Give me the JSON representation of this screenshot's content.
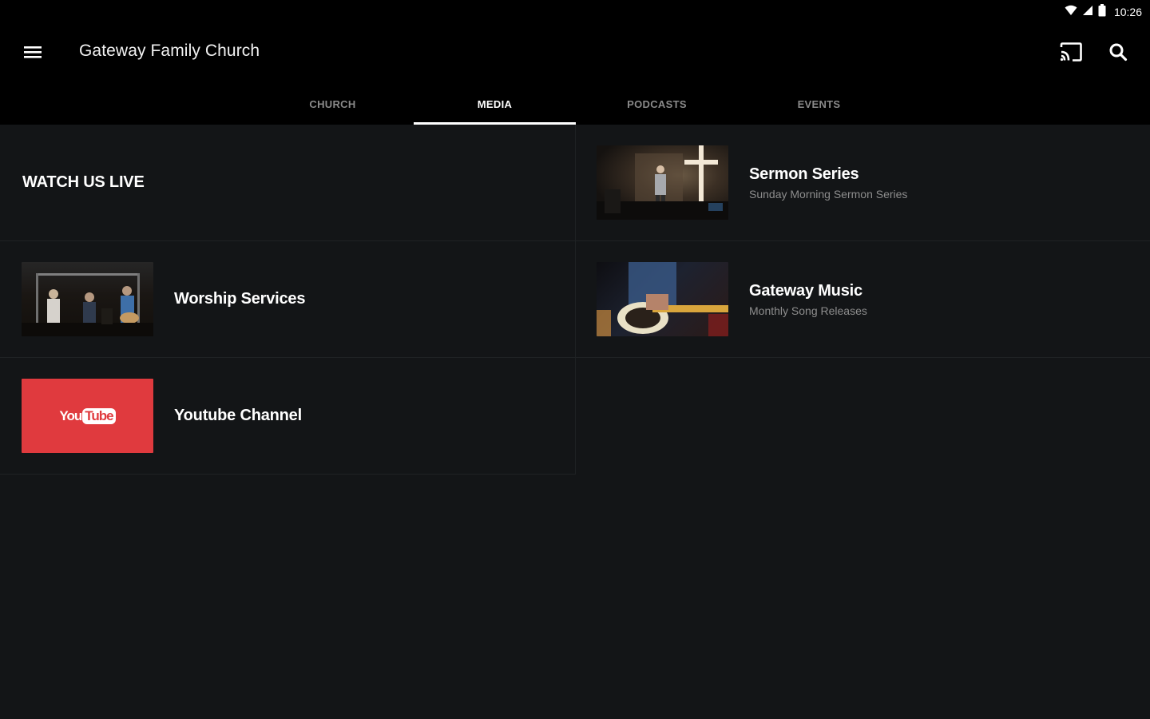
{
  "status_bar": {
    "time": "10:26"
  },
  "app_bar": {
    "title": "Gateway Family Church",
    "icons": [
      "menu-icon",
      "cast-icon",
      "search-icon"
    ]
  },
  "tabs": [
    {
      "label": "CHURCH",
      "active": false
    },
    {
      "label": "MEDIA",
      "active": true
    },
    {
      "label": "PODCASTS",
      "active": false
    },
    {
      "label": "EVENTS",
      "active": false
    }
  ],
  "media": {
    "watch_live": {
      "title": "WATCH US LIVE"
    },
    "sermon_series": {
      "title": "Sermon Series",
      "subtitle": "Sunday Morning Sermon Series"
    },
    "worship_services": {
      "title": "Worship Services"
    },
    "gateway_music": {
      "title": "Gateway Music",
      "subtitle": "Monthly Song Releases"
    },
    "youtube_channel": {
      "title": "Youtube Channel",
      "logo_left": "You",
      "logo_right": "Tube"
    }
  },
  "colors": {
    "background": "#131517",
    "app_bar": "#000000",
    "tab_inactive": "#8a8a8a",
    "youtube_red": "#e03a3e",
    "subtitle": "#8d8d8d"
  }
}
